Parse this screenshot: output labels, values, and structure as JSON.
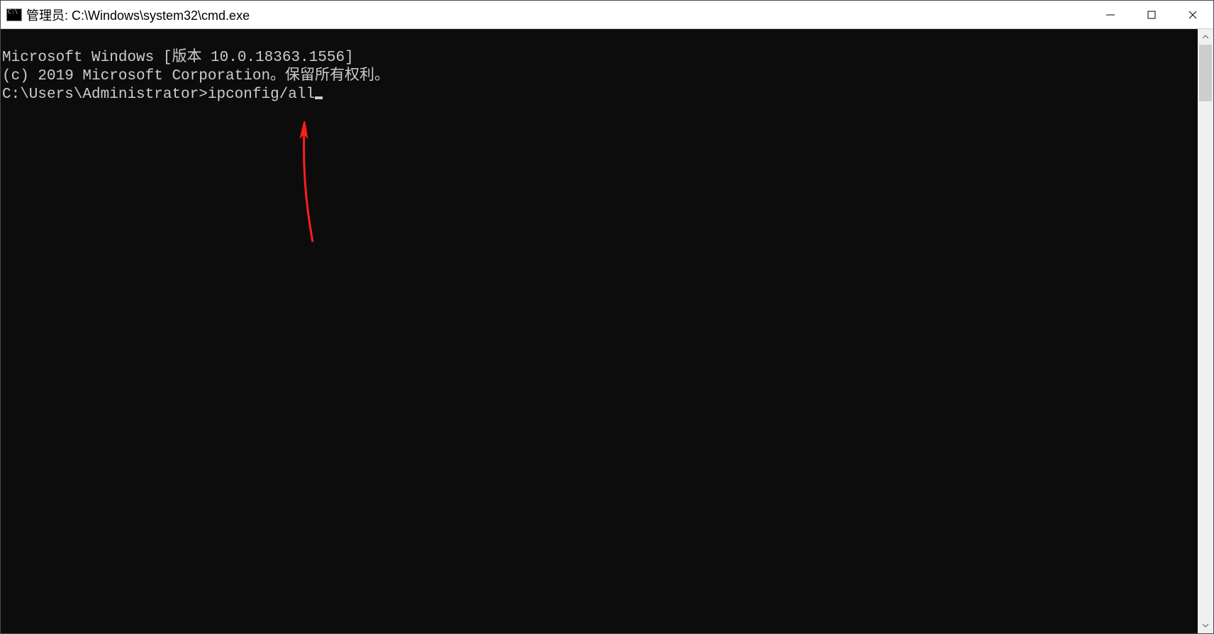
{
  "window": {
    "title": "管理员: C:\\Windows\\system32\\cmd.exe"
  },
  "terminal": {
    "line1": "Microsoft Windows [版本 10.0.18363.1556]",
    "line2": "(c) 2019 Microsoft Corporation。保留所有权利。",
    "blank": "",
    "prompt": "C:\\Users\\Administrator>",
    "command": "ipconfig/all"
  },
  "colors": {
    "terminal_bg": "#0c0c0c",
    "terminal_fg": "#cccccc",
    "arrow": "#ff1e1e"
  },
  "controls": {
    "minimize": "minimize",
    "maximize": "maximize",
    "close": "close"
  }
}
